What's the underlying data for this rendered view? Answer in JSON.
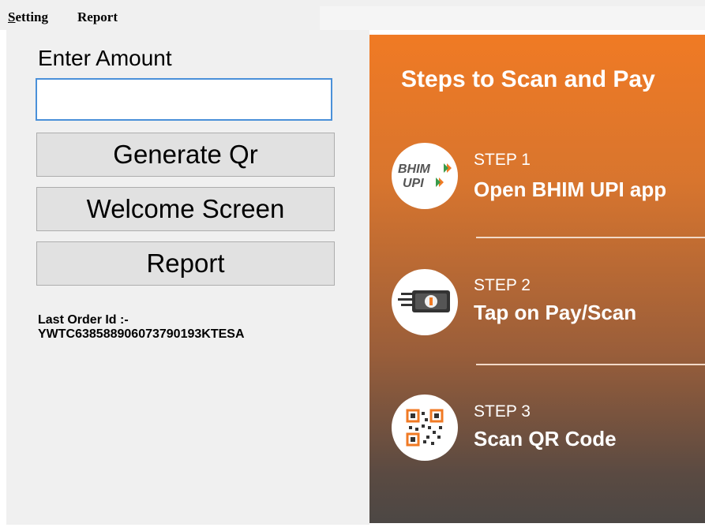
{
  "menu": {
    "setting": "Setting",
    "setting_accel": "S",
    "setting_rest": "etting",
    "report": "Report"
  },
  "form": {
    "amount_label": "Enter Amount",
    "amount_value": "",
    "generate_label": "Generate Qr",
    "welcome_label": "Welcome Screen",
    "report_label": "Report",
    "last_order_label": "Last Order Id :-",
    "last_order_value": "YWTC638588906073790193KTESA"
  },
  "steps_panel": {
    "title": "Steps to Scan and Pay",
    "steps": [
      {
        "number": "STEP 1",
        "text": "Open BHIM UPI app",
        "icon": "bhim-upi-logo-icon",
        "logo_text": [
          "BHIM",
          "UPI"
        ]
      },
      {
        "number": "STEP 2",
        "text": "Tap on Pay/Scan",
        "icon": "pay-scan-icon"
      },
      {
        "number": "STEP 3",
        "text": "Scan QR Code",
        "icon": "qr-code-icon"
      }
    ]
  },
  "colors": {
    "accent_orange": "#f07a24",
    "panel_dark": "#4c4744",
    "input_border": "#4a90d9"
  }
}
